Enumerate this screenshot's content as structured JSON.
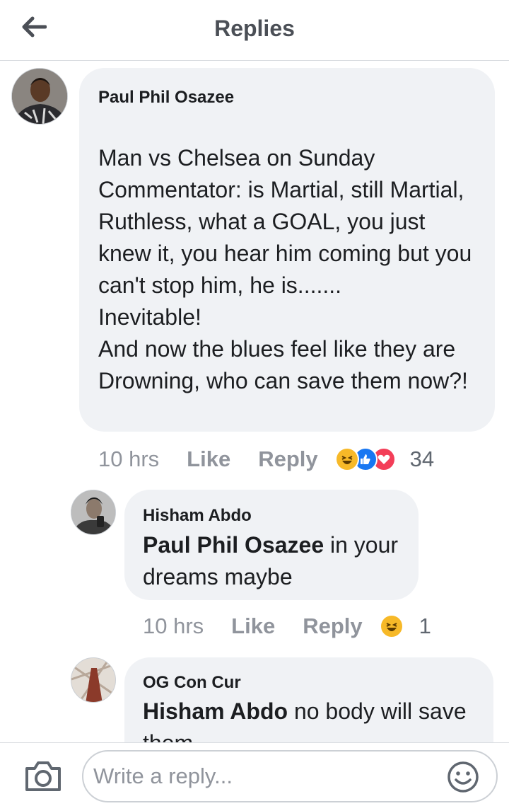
{
  "header": {
    "title": "Replies",
    "back_icon": "back-arrow-icon"
  },
  "comments": [
    {
      "author": "Paul Phil Osazee",
      "text": "Man vs Chelsea on Sunday\nCommentator: is Martial, still Martial, Ruthless, what a GOAL, you just knew it, you hear him coming but you can't stop him, he is.......\nInevitable!\nAnd now the blues feel like they are Drowning, who can save them now?!",
      "time": "10 hrs",
      "like_label": "Like",
      "reply_label": "Reply",
      "reactions": [
        "haha-reaction-icon",
        "like-reaction-icon",
        "love-reaction-icon"
      ],
      "reaction_count": "34"
    },
    {
      "author": "Hisham Abdo",
      "mention": "Paul Phil Osazee",
      "text": " in your dreams maybe",
      "time": "10 hrs",
      "like_label": "Like",
      "reply_label": "Reply",
      "reactions": [
        "haha-reaction-icon"
      ],
      "reaction_count": "1"
    },
    {
      "author": "OG Con Cur",
      "mention": "Hisham Abdo",
      "text": " no body will save them"
    }
  ],
  "composer": {
    "placeholder": "Write a reply...",
    "camera_icon": "camera-icon",
    "emoji_icon": "emoji-icon"
  },
  "colors": {
    "bubble": "#f0f2f5",
    "muted_text": "#90949c",
    "header_text": "#4b4f56",
    "like_blue": "#1877f2",
    "love_red": "#f33e58",
    "haha_yellow": "#f7b928"
  }
}
